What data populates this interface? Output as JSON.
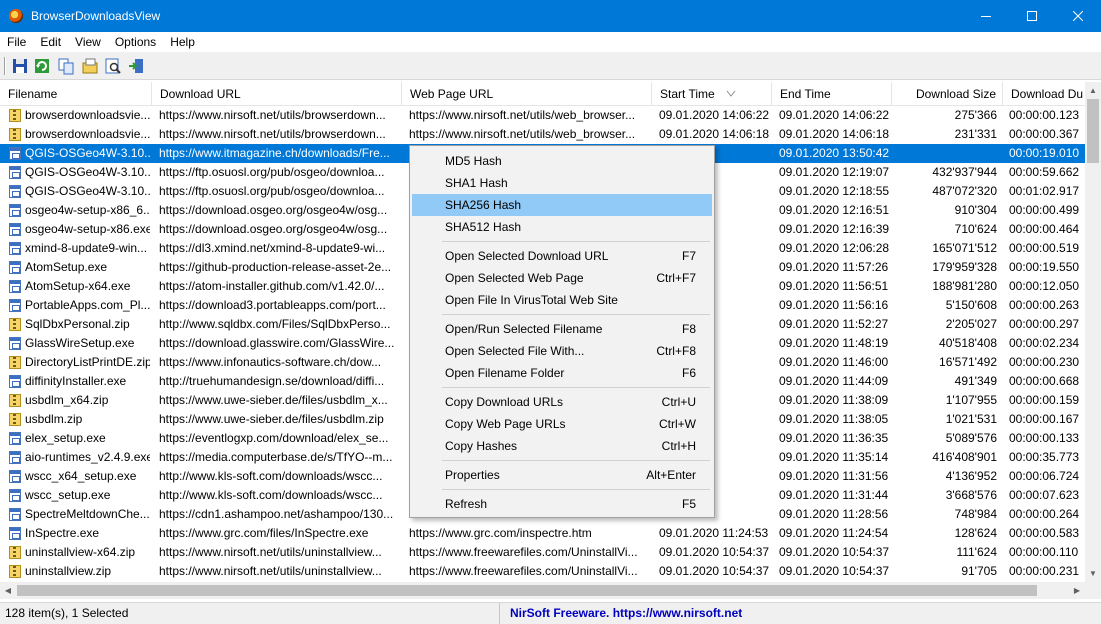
{
  "window": {
    "title": "BrowserDownloadsView"
  },
  "menubar": {
    "items": [
      "File",
      "Edit",
      "View",
      "Options",
      "Help"
    ]
  },
  "toolbar": {
    "icons": [
      "save-icon",
      "refresh-icon",
      "copy-icon",
      "properties-icon",
      "find-icon",
      "exit-icon"
    ]
  },
  "columns": [
    "Filename",
    "Download URL",
    "Web Page URL",
    "Start Time",
    "End Time",
    "Download Size",
    "Download Du"
  ],
  "rows": [
    {
      "icon": "zip",
      "filename": "browserdownloadsvie...",
      "url": "https://www.nirsoft.net/utils/browserdown...",
      "web": "https://www.nirsoft.net/utils/web_browser...",
      "start": "09.01.2020 14:06:22",
      "end": "09.01.2020 14:06:22",
      "size": "275'366",
      "dur": "00:00:00.123"
    },
    {
      "icon": "zip",
      "filename": "browserdownloadsvie...",
      "url": "https://www.nirsoft.net/utils/browserdown...",
      "web": "https://www.nirsoft.net/utils/web_browser...",
      "start": "09.01.2020 14:06:18",
      "end": "09.01.2020 14:06:18",
      "size": "231'331",
      "dur": "00:00:00.367"
    },
    {
      "icon": "exe",
      "filename": "QGIS-OSGeo4W-3.10....",
      "url": "https://www.itmagazine.ch/downloads/Fre...",
      "web": "",
      "start": "13:50:23",
      "end": "09.01.2020 13:50:42",
      "size": "",
      "dur": "00:00:19.010",
      "selected": true
    },
    {
      "icon": "exe",
      "filename": "QGIS-OSGeo4W-3.10....",
      "url": "https://ftp.osuosl.org/pub/osgeo/downloa...",
      "web": "",
      "start": "12:18:07",
      "end": "09.01.2020 12:19:07",
      "size": "432'937'944",
      "dur": "00:00:59.662"
    },
    {
      "icon": "exe",
      "filename": "QGIS-OSGeo4W-3.10....",
      "url": "https://ftp.osuosl.org/pub/osgeo/downloa...",
      "web": "",
      "start": "12:17:52",
      "end": "09.01.2020 12:18:55",
      "size": "487'072'320",
      "dur": "00:01:02.917"
    },
    {
      "icon": "exe",
      "filename": "osgeo4w-setup-x86_6...",
      "url": "https://download.osgeo.org/osgeo4w/osg...",
      "web": "",
      "start": "12:16:50",
      "end": "09.01.2020 12:16:51",
      "size": "910'304",
      "dur": "00:00:00.499"
    },
    {
      "icon": "exe",
      "filename": "osgeo4w-setup-x86.exe",
      "url": "https://download.osgeo.org/osgeo4w/osg...",
      "web": "",
      "start": "12:16:38",
      "end": "09.01.2020 12:16:39",
      "size": "710'624",
      "dur": "00:00:00.464"
    },
    {
      "icon": "exe",
      "filename": "xmind-8-update9-win...",
      "url": "https://dl3.xmind.net/xmind-8-update9-wi...",
      "web": "",
      "start": "12:06:27",
      "end": "09.01.2020 12:06:28",
      "size": "165'071'512",
      "dur": "00:00:00.519"
    },
    {
      "icon": "exe",
      "filename": "AtomSetup.exe",
      "url": "https://github-production-release-asset-2e...",
      "web": "",
      "start": "11:57:06",
      "end": "09.01.2020 11:57:26",
      "size": "179'959'328",
      "dur": "00:00:19.550"
    },
    {
      "icon": "exe",
      "filename": "AtomSetup-x64.exe",
      "url": "https://atom-installer.github.com/v1.42.0/...",
      "web": "",
      "start": "11:56:39",
      "end": "09.01.2020 11:56:51",
      "size": "188'981'280",
      "dur": "00:00:12.050"
    },
    {
      "icon": "exe",
      "filename": "PortableApps.com_Pl...",
      "url": "https://download3.portableapps.com/port...",
      "web": "",
      "start": "11:56:15",
      "end": "09.01.2020 11:56:16",
      "size": "5'150'608",
      "dur": "00:00:00.263"
    },
    {
      "icon": "zip",
      "filename": "SqlDbxPersonal.zip",
      "url": "http://www.sqldbx.com/Files/SqlDbxPerso...",
      "web": "",
      "start": "11:52:27",
      "end": "09.01.2020 11:52:27",
      "size": "2'205'027",
      "dur": "00:00:00.297"
    },
    {
      "icon": "exe",
      "filename": "GlassWireSetup.exe",
      "url": "https://download.glasswire.com/GlassWire...",
      "web": "",
      "start": "11:48:17",
      "end": "09.01.2020 11:48:19",
      "size": "40'518'408",
      "dur": "00:00:02.234"
    },
    {
      "icon": "zip",
      "filename": "DirectoryListPrintDE.zip",
      "url": "https://www.infonautics-software.ch/dow...",
      "web": "",
      "start": "11:45:59",
      "end": "09.01.2020 11:46:00",
      "size": "16'571'492",
      "dur": "00:00:00.230"
    },
    {
      "icon": "exe",
      "filename": "diffinityInstaller.exe",
      "url": "http://truehumandesign.se/download/diffi...",
      "web": "",
      "start": "11:44:09",
      "end": "09.01.2020 11:44:09",
      "size": "491'349",
      "dur": "00:00:00.668"
    },
    {
      "icon": "zip",
      "filename": "usbdlm_x64.zip",
      "url": "https://www.uwe-sieber.de/files/usbdlm_x...",
      "web": "",
      "start": "11:38:09",
      "end": "09.01.2020 11:38:09",
      "size": "1'107'955",
      "dur": "00:00:00.159"
    },
    {
      "icon": "zip",
      "filename": "usbdlm.zip",
      "url": "https://www.uwe-sieber.de/files/usbdlm.zip",
      "web": "",
      "start": "11:38:05",
      "end": "09.01.2020 11:38:05",
      "size": "1'021'531",
      "dur": "00:00:00.167"
    },
    {
      "icon": "exe",
      "filename": "elex_setup.exe",
      "url": "https://eventlogxp.com/download/elex_se...",
      "web": "",
      "start": "11:36:35",
      "end": "09.01.2020 11:36:35",
      "size": "5'089'576",
      "dur": "00:00:00.133"
    },
    {
      "icon": "exe",
      "filename": "aio-runtimes_v2.4.9.exe",
      "url": "https://media.computerbase.de/s/TfYO--m...",
      "web": "",
      "start": "11:34:38",
      "end": "09.01.2020 11:35:14",
      "size": "416'408'901",
      "dur": "00:00:35.773"
    },
    {
      "icon": "exe",
      "filename": "wscc_x64_setup.exe",
      "url": "http://www.kls-soft.com/downloads/wscc...",
      "web": "",
      "start": "11:31:49",
      "end": "09.01.2020 11:31:56",
      "size": "4'136'952",
      "dur": "00:00:06.724"
    },
    {
      "icon": "exe",
      "filename": "wscc_setup.exe",
      "url": "http://www.kls-soft.com/downloads/wscc...",
      "web": "",
      "start": "11:31:37",
      "end": "09.01.2020 11:31:44",
      "size": "3'668'576",
      "dur": "00:00:07.623"
    },
    {
      "icon": "exe",
      "filename": "SpectreMeltdownChe...",
      "url": "https://cdn1.ashampoo.net/ashampoo/130...",
      "web": "",
      "start": "11:28:56",
      "end": "09.01.2020 11:28:56",
      "size": "748'984",
      "dur": "00:00:00.264"
    },
    {
      "icon": "exe",
      "filename": "InSpectre.exe",
      "url": "https://www.grc.com/files/InSpectre.exe",
      "web": "https://www.grc.com/inspectre.htm",
      "start": "09.01.2020 11:24:53",
      "end": "09.01.2020 11:24:54",
      "size": "128'624",
      "dur": "00:00:00.583"
    },
    {
      "icon": "zip",
      "filename": "uninstallview-x64.zip",
      "url": "https://www.nirsoft.net/utils/uninstallview...",
      "web": "https://www.freewarefiles.com/UninstallVi...",
      "start": "09.01.2020 10:54:37",
      "end": "09.01.2020 10:54:37",
      "size": "111'624",
      "dur": "00:00:00.110"
    },
    {
      "icon": "zip",
      "filename": "uninstallview.zip",
      "url": "https://www.nirsoft.net/utils/uninstallview...",
      "web": "https://www.freewarefiles.com/UninstallVi...",
      "start": "09.01.2020 10:54:37",
      "end": "09.01.2020 10:54:37",
      "size": "91'705",
      "dur": "00:00:00.231"
    }
  ],
  "context_menu": {
    "groups": [
      [
        {
          "label": "MD5 Hash",
          "key": ""
        },
        {
          "label": "SHA1 Hash",
          "key": ""
        },
        {
          "label": "SHA256 Hash",
          "key": "",
          "highlighted": true
        },
        {
          "label": "SHA512 Hash",
          "key": ""
        }
      ],
      [
        {
          "label": "Open Selected Download URL",
          "key": "F7"
        },
        {
          "label": "Open Selected Web Page",
          "key": "Ctrl+F7"
        },
        {
          "label": "Open File In VirusTotal Web Site",
          "key": ""
        }
      ],
      [
        {
          "label": "Open/Run Selected Filename",
          "key": "F8"
        },
        {
          "label": "Open Selected File With...",
          "key": "Ctrl+F8"
        },
        {
          "label": "Open Filename Folder",
          "key": "F6"
        }
      ],
      [
        {
          "label": "Copy Download URLs",
          "key": "Ctrl+U"
        },
        {
          "label": "Copy Web Page URLs",
          "key": "Ctrl+W"
        },
        {
          "label": "Copy Hashes",
          "key": "Ctrl+H"
        }
      ],
      [
        {
          "label": "Properties",
          "key": "Alt+Enter"
        }
      ],
      [
        {
          "label": "Refresh",
          "key": "F5"
        }
      ]
    ]
  },
  "statusbar": {
    "count": "128 item(s), 1 Selected",
    "credit": "NirSoft Freeware. https://www.nirsoft.net"
  },
  "colors": {
    "titlebar": "#0078d7",
    "selection": "#0078d7",
    "menu_highlight": "#91c9f7",
    "credit": "#0000c0"
  }
}
